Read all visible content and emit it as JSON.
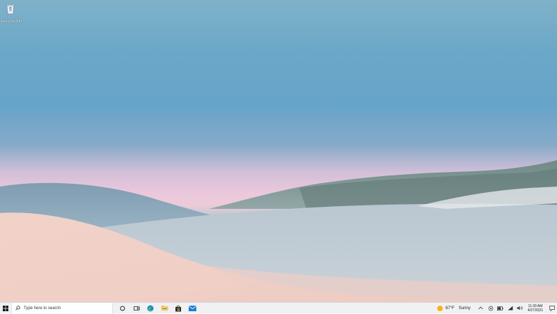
{
  "desktop": {
    "icons": [
      {
        "label": "Recycle Bin",
        "icon": "recycle-bin-icon"
      }
    ]
  },
  "taskbar": {
    "start_icon": "windows-logo-icon",
    "search": {
      "placeholder": "Type here to search",
      "icon": "search-icon"
    },
    "pinned": [
      {
        "name": "cortana",
        "icon": "cortana-icon"
      },
      {
        "name": "task-view",
        "icon": "task-view-icon"
      },
      {
        "name": "edge",
        "icon": "edge-icon"
      },
      {
        "name": "file-explorer",
        "icon": "folder-icon"
      },
      {
        "name": "store",
        "icon": "store-icon"
      },
      {
        "name": "mail",
        "icon": "mail-icon"
      }
    ],
    "weather": {
      "temp": "67°F",
      "condition": "Sunny",
      "icon": "sun-icon"
    },
    "tray_icons": [
      "chevron-up-icon",
      "network-icon",
      "battery-icon",
      "wifi-icon",
      "volume-icon"
    ],
    "clock": {
      "time": "11:30 AM",
      "date": "4/27/2021"
    },
    "notification_icon": "notification-icon"
  },
  "colors": {
    "taskbar_bg": "#f1f1f3",
    "accent": "#0078d4"
  }
}
